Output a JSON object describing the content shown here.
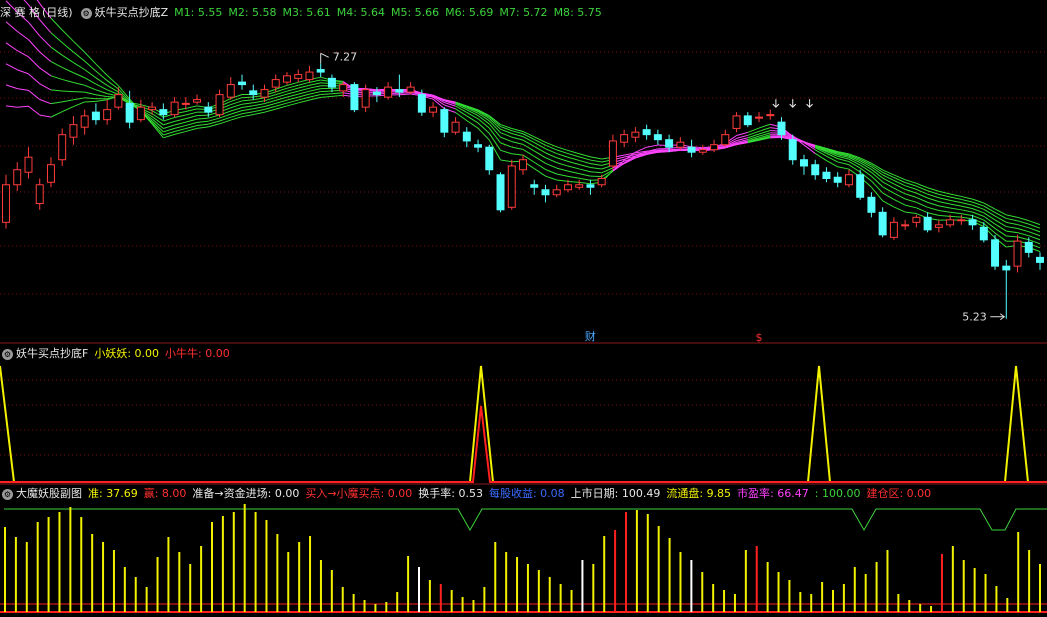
{
  "main": {
    "stock_name": "深 赛 格",
    "period": "(日线)",
    "indicator": "妖牛买点抄底Z",
    "ma_labels": [
      {
        "name": "M1",
        "value": "5.55"
      },
      {
        "name": "M2",
        "value": "5.58"
      },
      {
        "name": "M3",
        "value": "5.61"
      },
      {
        "name": "M4",
        "value": "5.64"
      },
      {
        "name": "M5",
        "value": "5.66"
      },
      {
        "name": "M6",
        "value": "5.69"
      },
      {
        "name": "M7",
        "value": "5.72"
      },
      {
        "name": "M8",
        "value": "5.75"
      }
    ],
    "high_annotation": "7.27",
    "low_annotation": "5.23",
    "marker_cai": "财",
    "marker_s": "$"
  },
  "sub1": {
    "indicator": "妖牛买点抄底F",
    "label1": "小妖妖",
    "value1": "0.00",
    "label2": "小牛牛",
    "value2": "0.00"
  },
  "sub2": {
    "indicator": "大魔妖股副图",
    "items": [
      {
        "label": "准",
        "value": "37.69",
        "color": "y"
      },
      {
        "label": "赢",
        "value": "8.00",
        "color": "r"
      },
      {
        "label": "准备→资金进场",
        "value": "0.00",
        "color": "w"
      },
      {
        "label": "买入→小魔买点",
        "value": "0.00",
        "color": "r"
      },
      {
        "label": "换手率",
        "value": "0.53",
        "color": "w"
      },
      {
        "label": "每股收益",
        "value": "0.08",
        "color": "b"
      },
      {
        "label": "上市日期",
        "value": "100.49",
        "color": "w"
      },
      {
        "label": "流通盘",
        "value": "9.85",
        "color": "y"
      },
      {
        "label": "市盈率",
        "value": "66.47",
        "color": "m"
      },
      {
        "label": "",
        "value": "100.00",
        "color": "g"
      },
      {
        "label": "建仓区",
        "value": "0.00",
        "color": "r"
      }
    ]
  },
  "colors": {
    "up": "#ff3c3c",
    "down": "#54ffff",
    "ma_green": "#33dd33",
    "ma_magenta": "#ff44ff",
    "grid": "#7a1010",
    "yellow": "#f2f200",
    "red": "#ff2020"
  },
  "chart_data": {
    "type": "candlestick",
    "candles": [
      [
        6.0,
        6.3,
        6.38,
        5.95
      ],
      [
        6.3,
        6.42,
        6.48,
        6.25
      ],
      [
        6.4,
        6.52,
        6.6,
        6.35
      ],
      [
        6.15,
        6.3,
        6.35,
        6.1
      ],
      [
        6.32,
        6.46,
        6.52,
        6.28
      ],
      [
        6.5,
        6.7,
        6.75,
        6.45
      ],
      [
        6.68,
        6.78,
        6.85,
        6.62
      ],
      [
        6.76,
        6.85,
        6.9,
        6.7
      ],
      [
        6.88,
        6.82,
        6.95,
        6.78
      ],
      [
        6.82,
        6.9,
        6.98,
        6.78
      ],
      [
        6.92,
        7.02,
        7.08,
        6.9
      ],
      [
        6.95,
        6.8,
        7.05,
        6.75
      ],
      [
        6.82,
        6.92,
        6.98,
        6.8
      ],
      [
        6.9,
        6.92,
        6.96,
        6.86
      ],
      [
        6.9,
        6.86,
        6.95,
        6.82
      ],
      [
        6.86,
        6.96,
        7.0,
        6.84
      ],
      [
        6.95,
        6.95,
        7.0,
        6.9
      ],
      [
        6.96,
        6.98,
        7.02,
        6.94
      ],
      [
        6.92,
        6.88,
        6.96,
        6.84
      ],
      [
        6.86,
        7.02,
        7.06,
        6.84
      ],
      [
        7.0,
        7.1,
        7.16,
        6.98
      ],
      [
        7.12,
        7.1,
        7.18,
        7.06
      ],
      [
        7.05,
        7.02,
        7.1,
        6.98
      ],
      [
        7.0,
        7.06,
        7.1,
        6.96
      ],
      [
        7.08,
        7.14,
        7.18,
        7.04
      ],
      [
        7.12,
        7.17,
        7.2,
        7.1
      ],
      [
        7.15,
        7.18,
        7.22,
        7.12
      ],
      [
        7.14,
        7.2,
        7.25,
        7.12
      ],
      [
        7.22,
        7.2,
        7.27,
        7.16
      ],
      [
        7.15,
        7.08,
        7.18,
        7.04
      ],
      [
        7.05,
        7.1,
        7.12,
        7.0
      ],
      [
        7.1,
        6.9,
        7.12,
        6.88
      ],
      [
        6.92,
        7.06,
        7.1,
        6.88
      ],
      [
        7.04,
        7.02,
        7.08,
        6.96
      ],
      [
        7.0,
        7.08,
        7.12,
        6.98
      ],
      [
        7.06,
        7.04,
        7.18,
        7.0
      ],
      [
        7.04,
        7.08,
        7.12,
        7.02
      ],
      [
        7.02,
        6.88,
        7.06,
        6.85
      ],
      [
        6.88,
        6.92,
        6.96,
        6.84
      ],
      [
        6.9,
        6.72,
        6.92,
        6.68
      ],
      [
        6.72,
        6.8,
        6.84,
        6.7
      ],
      [
        6.72,
        6.65,
        6.76,
        6.6
      ],
      [
        6.62,
        6.6,
        6.66,
        6.56
      ],
      [
        6.6,
        6.42,
        6.62,
        6.38
      ],
      [
        6.38,
        6.1,
        6.4,
        6.08
      ],
      [
        6.12,
        6.45,
        6.5,
        6.1
      ],
      [
        6.42,
        6.5,
        6.54,
        6.38
      ],
      [
        6.3,
        6.28,
        6.34,
        6.22
      ],
      [
        6.26,
        6.22,
        6.3,
        6.16
      ],
      [
        6.22,
        6.26,
        6.3,
        6.2
      ],
      [
        6.26,
        6.3,
        6.34,
        6.24
      ],
      [
        6.28,
        6.3,
        6.34,
        6.26
      ],
      [
        6.3,
        6.28,
        6.34,
        6.22
      ],
      [
        6.3,
        6.35,
        6.38,
        6.28
      ],
      [
        6.45,
        6.65,
        6.7,
        6.42
      ],
      [
        6.64,
        6.7,
        6.74,
        6.6
      ],
      [
        6.68,
        6.72,
        6.76,
        6.64
      ],
      [
        6.74,
        6.7,
        6.78,
        6.66
      ],
      [
        6.7,
        6.66,
        6.74,
        6.62
      ],
      [
        6.66,
        6.6,
        6.7,
        6.56
      ],
      [
        6.6,
        6.64,
        6.68,
        6.58
      ],
      [
        6.6,
        6.56,
        6.66,
        6.52
      ],
      [
        6.56,
        6.58,
        6.62,
        6.54
      ],
      [
        6.58,
        6.62,
        6.66,
        6.56
      ],
      [
        6.62,
        6.7,
        6.74,
        6.6
      ],
      [
        6.75,
        6.85,
        6.88,
        6.72
      ],
      [
        6.85,
        6.78,
        6.88,
        6.76
      ],
      [
        6.84,
        6.84,
        6.88,
        6.8
      ],
      [
        6.86,
        6.86,
        6.9,
        6.82
      ],
      [
        6.8,
        6.7,
        6.84,
        6.66
      ],
      [
        6.66,
        6.5,
        6.7,
        6.46
      ],
      [
        6.5,
        6.45,
        6.54,
        6.38
      ],
      [
        6.46,
        6.38,
        6.5,
        6.34
      ],
      [
        6.4,
        6.35,
        6.44,
        6.32
      ],
      [
        6.36,
        6.32,
        6.4,
        6.28
      ],
      [
        6.3,
        6.38,
        6.42,
        6.28
      ],
      [
        6.38,
        6.2,
        6.42,
        6.18
      ],
      [
        6.2,
        6.08,
        6.24,
        6.04
      ],
      [
        6.08,
        5.9,
        6.12,
        5.88
      ],
      [
        5.88,
        6.0,
        6.04,
        5.86
      ],
      [
        5.98,
        5.98,
        6.02,
        5.94
      ],
      [
        6.0,
        6.04,
        6.06,
        5.96
      ],
      [
        6.04,
        5.94,
        6.08,
        5.92
      ],
      [
        5.96,
        5.98,
        6.02,
        5.92
      ],
      [
        5.98,
        6.02,
        6.06,
        5.96
      ],
      [
        6.02,
        6.02,
        6.06,
        5.98
      ],
      [
        6.02,
        5.98,
        6.06,
        5.94
      ],
      [
        5.96,
        5.86,
        6.0,
        5.84
      ],
      [
        5.86,
        5.65,
        5.9,
        5.62
      ],
      [
        5.65,
        5.62,
        5.7,
        5.23
      ],
      [
        5.65,
        5.85,
        5.9,
        5.6
      ],
      [
        5.84,
        5.76,
        5.88,
        5.72
      ],
      [
        5.72,
        5.68,
        5.76,
        5.62
      ]
    ],
    "price_range": [
      5.1,
      7.6
    ],
    "annotations": [
      {
        "text": "7.27",
        "value": 7.27
      },
      {
        "text": "5.23",
        "value": 5.23
      }
    ]
  }
}
